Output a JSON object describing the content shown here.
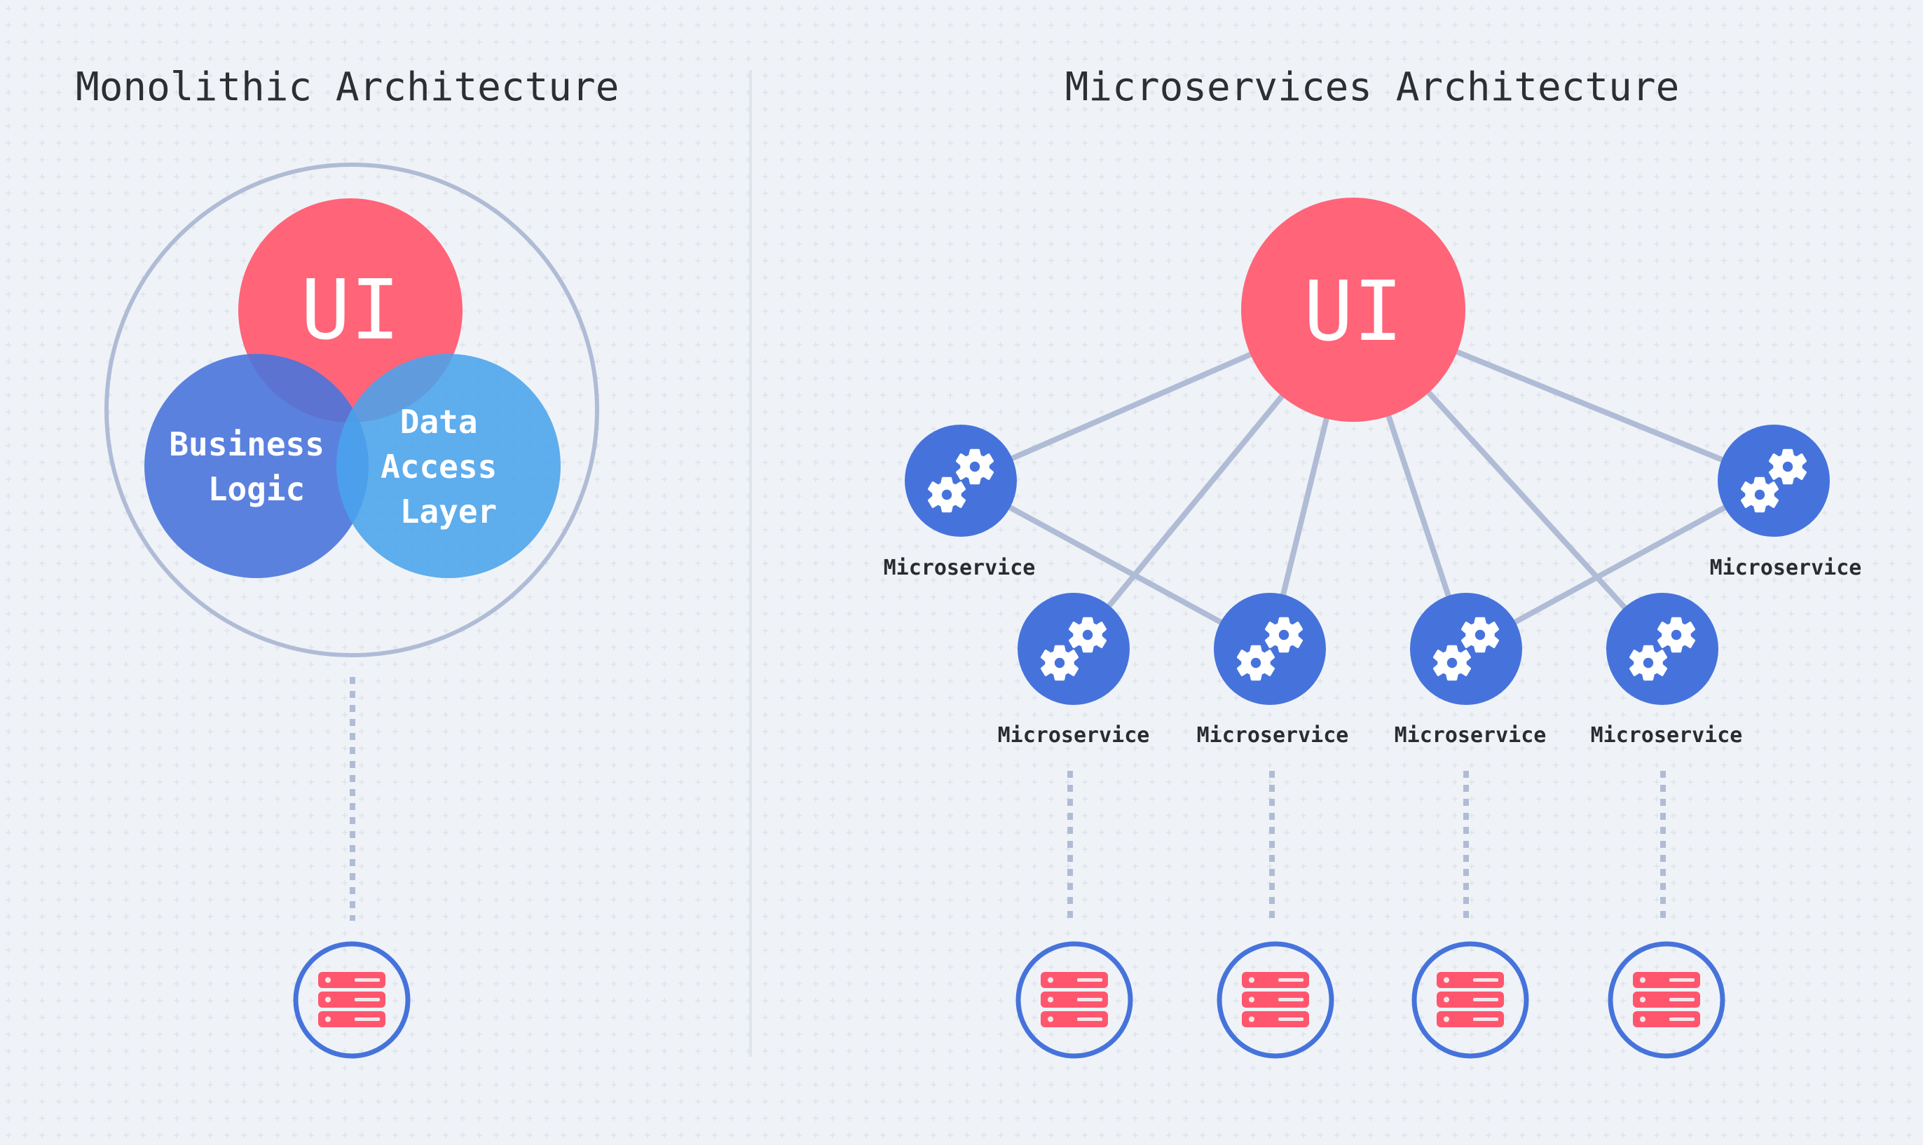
{
  "colors": {
    "background": "#eff3f7",
    "grid": "#dde3ec",
    "ui_red": "#ff6479",
    "business_blue": "#4a74dc",
    "data_blue": "#4aa3ec",
    "service_blue": "#4673db",
    "connector": "#b0bcd6",
    "db_ring": "#4673db",
    "db_red": "#ff566e",
    "divider": "#dfe4eb",
    "text": "#2d2f33"
  },
  "monolithic": {
    "title": "Monolithic Architecture",
    "ui_label": "UI",
    "business_logic_lines": [
      "Business",
      "Logic"
    ],
    "data_access_lines": [
      "Data",
      "Access",
      "Layer"
    ],
    "database": {
      "icon": "database-server-icon"
    }
  },
  "microservices": {
    "title": "Microservices Architecture",
    "ui_label": "UI",
    "services": [
      {
        "label": "Microservice",
        "icon": "gears-icon",
        "has_database": false
      },
      {
        "label": "Microservice",
        "icon": "gears-icon",
        "has_database": false
      },
      {
        "label": "Microservice",
        "icon": "gears-icon",
        "has_database": true
      },
      {
        "label": "Microservice",
        "icon": "gears-icon",
        "has_database": true
      },
      {
        "label": "Microservice",
        "icon": "gears-icon",
        "has_database": true
      },
      {
        "label": "Microservice",
        "icon": "gears-icon",
        "has_database": true
      }
    ],
    "connections": [
      [
        "ui",
        0
      ],
      [
        "ui",
        1
      ],
      [
        "ui",
        2
      ],
      [
        "ui",
        3
      ],
      [
        "ui",
        4
      ],
      [
        "ui",
        5
      ],
      [
        0,
        3
      ],
      [
        1,
        4
      ]
    ]
  }
}
